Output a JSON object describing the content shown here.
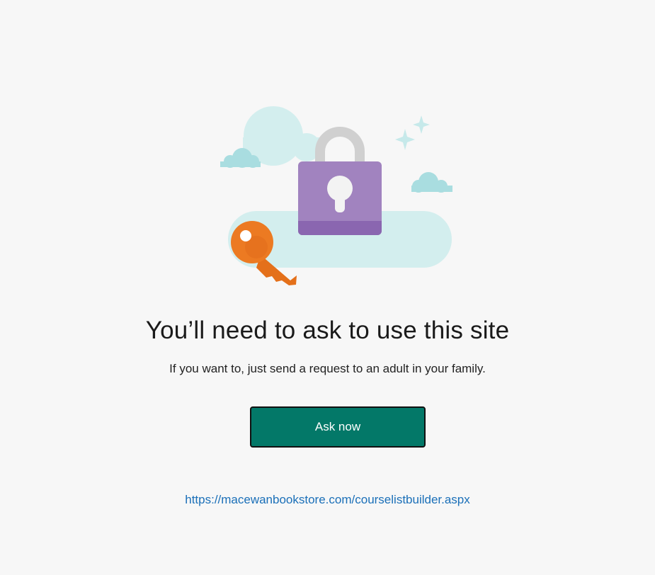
{
  "page": {
    "heading": "You’ll need to ask to use this site",
    "subtitle": "If you want to, just send a request to an adult in your family.",
    "button_label": "Ask now",
    "site_url": "https://macewanbookstore.com/courselistbuilder.aspx"
  },
  "illustration": {
    "icons": [
      "lock-icon",
      "key-icon",
      "cloud-icon",
      "sparkle-icon"
    ]
  },
  "colors": {
    "background": "#f7f7f7",
    "button": "#037868",
    "link": "#1a6fb8",
    "lock_body": "#a081bf",
    "key": "#ec7a22",
    "cloud": "#d2eeee"
  }
}
